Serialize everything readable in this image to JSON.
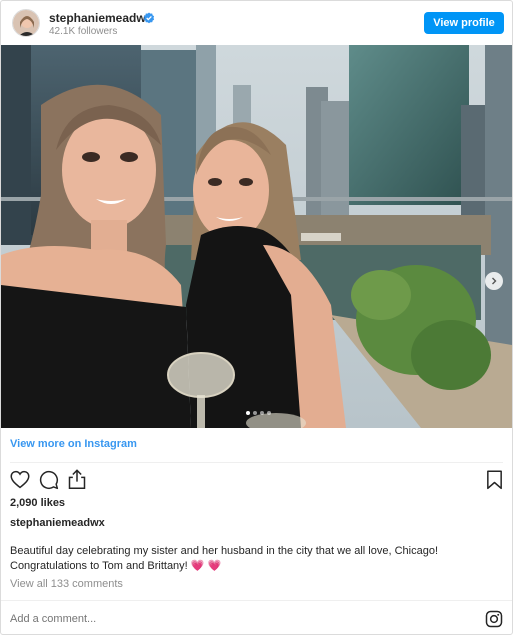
{
  "header": {
    "username": "stephaniemeadwx",
    "followers": "42.1K followers",
    "view_profile_label": "View profile"
  },
  "post": {
    "carousel_dots": 4,
    "active_dot": 0
  },
  "view_more_label": "View more on Instagram",
  "likes": "2,090 likes",
  "caption": {
    "username": "stephaniemeadwx",
    "text": "Beautiful day celebrating my sister and her husband in the city that we all love, Chicago! Congratulations to Tom and Brittany!",
    "emoji": "💗 💗"
  },
  "view_comments_label": "View all 133 comments",
  "add_comment_placeholder": "Add a comment...",
  "colors": {
    "accent": "#0095f6",
    "link": "#3897f0",
    "muted": "#8e8e8e",
    "heart": "#ed4956"
  },
  "icons": [
    "verified-badge-icon",
    "heart-icon",
    "comment-icon",
    "share-icon",
    "bookmark-icon",
    "chevron-right-icon",
    "instagram-icon"
  ]
}
